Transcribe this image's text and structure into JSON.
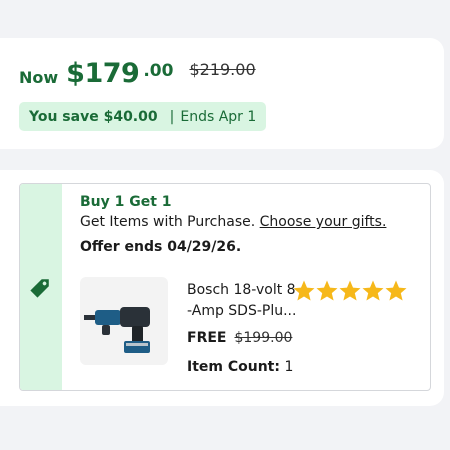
{
  "price": {
    "now_label": "Now",
    "dollars": "$179",
    "cents": ".00",
    "was": "$219.00",
    "savings": "You save $40.00",
    "separator": "|",
    "ends": "Ends Apr 1"
  },
  "promo": {
    "icon": "price-tag-icon",
    "title": "Buy 1 Get 1",
    "line_prefix": "Get Items with Purchase.",
    "link": "Choose your gifts.",
    "offer_ends": "Offer ends 04/29/26."
  },
  "product": {
    "name_line1": "Bosch 18-volt 8",
    "name_line2": "-Amp SDS-Plu...",
    "rating_stars": 5,
    "price": "FREE",
    "was": "$199.00",
    "count_label": "Item Count:",
    "count_value": "1"
  },
  "colors": {
    "brand_green": "#1a6b37",
    "pill_bg": "#d9f5e2",
    "star": "#f6b81a"
  }
}
